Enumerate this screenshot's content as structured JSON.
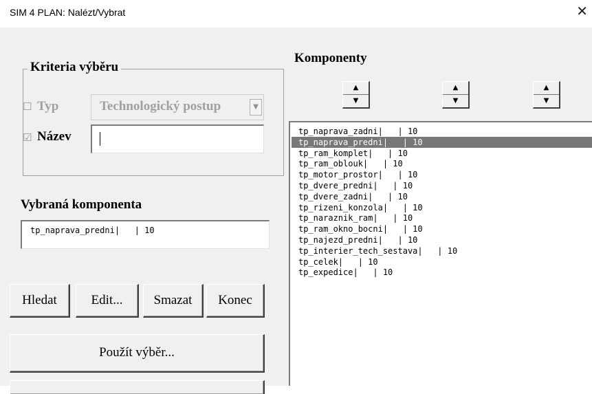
{
  "window": {
    "title": "SIM 4 PLAN: Nalézt/Vybrat",
    "close_glyph": "✕"
  },
  "criteria": {
    "title": "Kriteria výběru",
    "typ": {
      "label": "Typ",
      "checked": false,
      "check_glyph": "☐",
      "value": "Technologický postup",
      "arrow": "▼"
    },
    "nazev": {
      "label": "Název",
      "checked": true,
      "check_glyph": "☑",
      "value": ""
    }
  },
  "selected": {
    "title": "Vybraná komponenta",
    "value": "tp_naprava_predni|   | 10"
  },
  "buttons": {
    "hledat": "Hledat",
    "edit": "Edit...",
    "smazat": "Smazat",
    "konec": "Konec",
    "pouzit": "Použít výběr..."
  },
  "components": {
    "title": "Komponenty",
    "spin_up": "▲",
    "spin_down": "▼",
    "selected_index": 1,
    "items": [
      "tp_naprava_zadni|   | 10",
      "tp_naprava_predni|   | 10",
      "tp_ram_komplet|   | 10",
      "tp_ram_oblouk|   | 10",
      "tp_motor_prostor|   | 10",
      "tp_dvere_predni|   | 10",
      "tp_dvere_zadni|   | 10",
      "tp_rizeni_konzola|   | 10",
      "tp_naraznik_ram|   | 10",
      "tp_ram_okno_bocni|   | 10",
      "tp_najezd_predni|   | 10",
      "tp_interier_tech_sestava|   | 10",
      "tp_celek|   | 10",
      "tp_expedice|   | 10"
    ]
  },
  "colors": {
    "selection": "#777777",
    "background": "#f0f0f0",
    "disabled_text": "#a0a0a0"
  }
}
